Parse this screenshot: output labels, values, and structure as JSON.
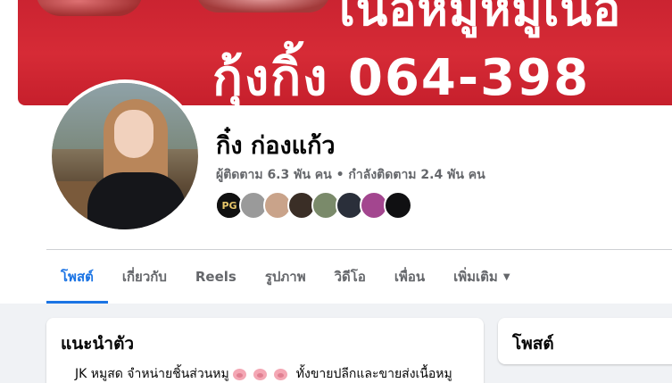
{
  "cover": {
    "headline": "เนื้อหมูหมูเนื้อ",
    "phone": "กุ้งกิ้ง 064-398"
  },
  "profile": {
    "name": "กิ๋ง ก่องแก้ว",
    "stats": "ผู้ติดตาม 6.3 พัน คน • กำลังติดตาม 2.4 พัน คน",
    "friends": [
      {
        "kind": "pg-logo",
        "label": "PG",
        "color": "#111111"
      },
      {
        "kind": "photo",
        "color": "#9a9a9a"
      },
      {
        "kind": "photo",
        "color": "#c9a38a"
      },
      {
        "kind": "photo",
        "color": "#3a2e26"
      },
      {
        "kind": "photo",
        "color": "#7a8a6a"
      },
      {
        "kind": "photo",
        "color": "#2a2f3a"
      },
      {
        "kind": "photo",
        "color": "#a3468f"
      },
      {
        "kind": "photo",
        "color": "#101012"
      }
    ]
  },
  "tabs": [
    {
      "label": "โพสต์",
      "active": true
    },
    {
      "label": "เกี่ยวกับ",
      "active": false
    },
    {
      "label": "Reels",
      "active": false
    },
    {
      "label": "รูปภาพ",
      "active": false
    },
    {
      "label": "วิดีโอ",
      "active": false
    },
    {
      "label": "เพื่อน",
      "active": false
    },
    {
      "label": "เพิ่มเติม",
      "active": false,
      "dropdown": true
    }
  ],
  "intro": {
    "title": "แนะนำตัว",
    "text_start": "JK หมูสด จำหน่ายชิ้นส่วนหมู",
    "text_end": "ทั้งขายปลีกและขายส่งเนื้อหมู"
  },
  "posts": {
    "title": "โพสต์"
  },
  "colors": {
    "accent": "#1b74e4",
    "cover_red": "#d62b36",
    "page_bg": "#f0f2f5"
  }
}
